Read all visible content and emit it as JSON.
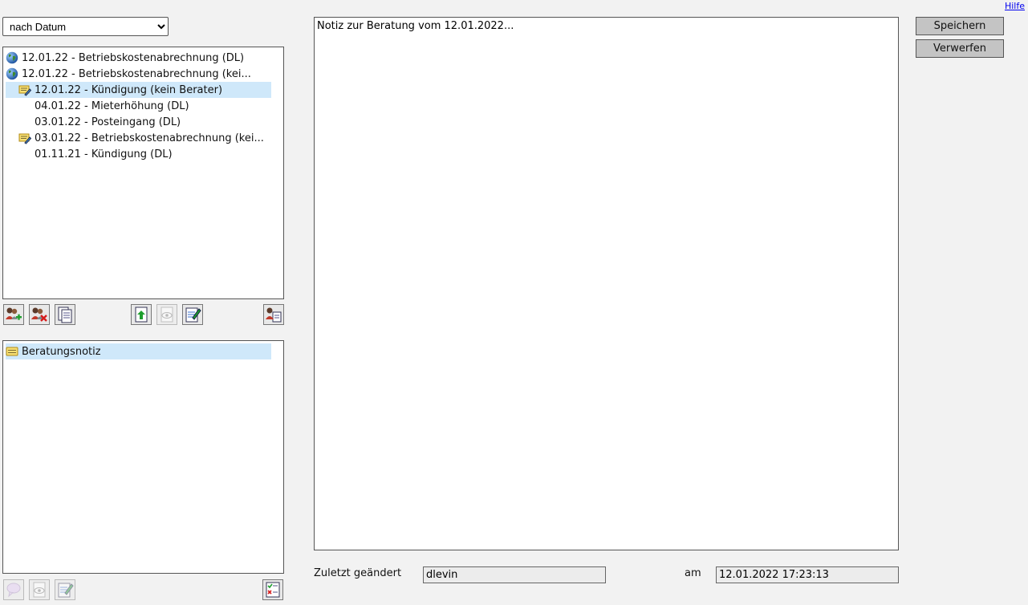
{
  "help": {
    "label": "Hilfe"
  },
  "sort": {
    "selected": "nach Datum"
  },
  "cases": [
    {
      "label": "12.01.22 - Betriebskostenabrechnung (DL)",
      "icon": "globe-icon",
      "selected": false
    },
    {
      "label": "12.01.22 - Betriebskostenabrechnung (kei...",
      "icon": "globe-icon",
      "selected": false
    },
    {
      "label": "12.01.22 - Kündigung (kein Berater)",
      "icon": "note-pencil-icon",
      "selected": true
    },
    {
      "label": "04.01.22 - Mieterhöhung (DL)",
      "icon": "",
      "selected": false
    },
    {
      "label": "03.01.22 - Posteingang (DL)",
      "icon": "",
      "selected": false
    },
    {
      "label": "03.01.22 - Betriebskostenabrechnung (kei...",
      "icon": "note-pencil-icon",
      "selected": false
    },
    {
      "label": "01.11.21 - Kündigung (DL)",
      "icon": "",
      "selected": false
    }
  ],
  "case_toolbar": [
    {
      "name": "add-person-button",
      "icon": "add-person-icon",
      "enabled": true
    },
    {
      "name": "remove-person-button",
      "icon": "remove-person-icon",
      "enabled": true
    },
    {
      "name": "document-list-button",
      "icon": "document-list-icon",
      "enabled": true
    },
    {
      "name": "upload-button",
      "icon": "upload-icon",
      "enabled": true
    },
    {
      "name": "view-button",
      "icon": "eye-icon",
      "enabled": false
    },
    {
      "name": "edit-document-button",
      "icon": "edit-document-icon",
      "enabled": true
    },
    {
      "name": "person-details-button",
      "icon": "person-document-icon",
      "enabled": true
    }
  ],
  "notes": [
    {
      "label": "Beratungsnotiz",
      "icon": "note-icon",
      "selected": true
    }
  ],
  "note_toolbar": [
    {
      "name": "new-note-button",
      "icon": "speech-bubble-icon",
      "enabled": false
    },
    {
      "name": "view-note-button",
      "icon": "eye-icon",
      "enabled": false
    },
    {
      "name": "edit-note-button",
      "icon": "edit-document-icon",
      "enabled": false
    },
    {
      "name": "checklist-button",
      "icon": "checklist-icon",
      "enabled": true
    }
  ],
  "editor": {
    "content": "Notiz zur Beratung vom 12.01.2022..."
  },
  "actions": {
    "save_label": "Speichern",
    "discard_label": "Verwerfen"
  },
  "footer": {
    "changed_by_label": "Zuletzt geändert",
    "changed_by_value": "dlevin",
    "date_label": "am",
    "date_value": "12.01.2022 17:23:13"
  },
  "colors": {
    "selection": "#cfe8fa",
    "button": "#c4c4c4",
    "background": "#f2f2f2"
  }
}
